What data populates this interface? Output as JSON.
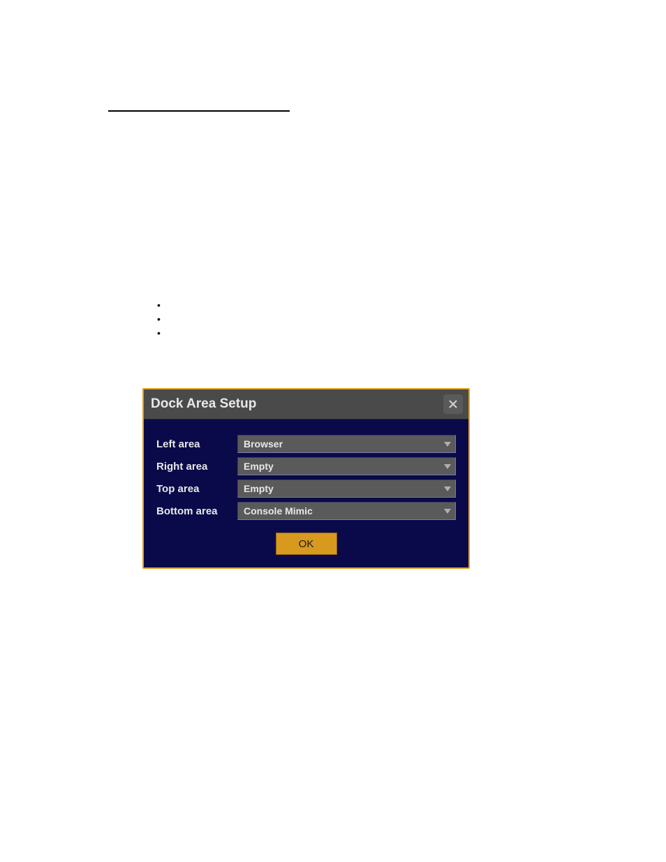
{
  "dialog": {
    "title": "Dock Area Setup",
    "rows": [
      {
        "label": "Left area",
        "value": "Browser"
      },
      {
        "label": "Right area",
        "value": "Empty"
      },
      {
        "label": "Top area",
        "value": "Empty"
      },
      {
        "label": "Bottom area",
        "value": "Console Mimic"
      }
    ],
    "ok_label": "OK"
  }
}
